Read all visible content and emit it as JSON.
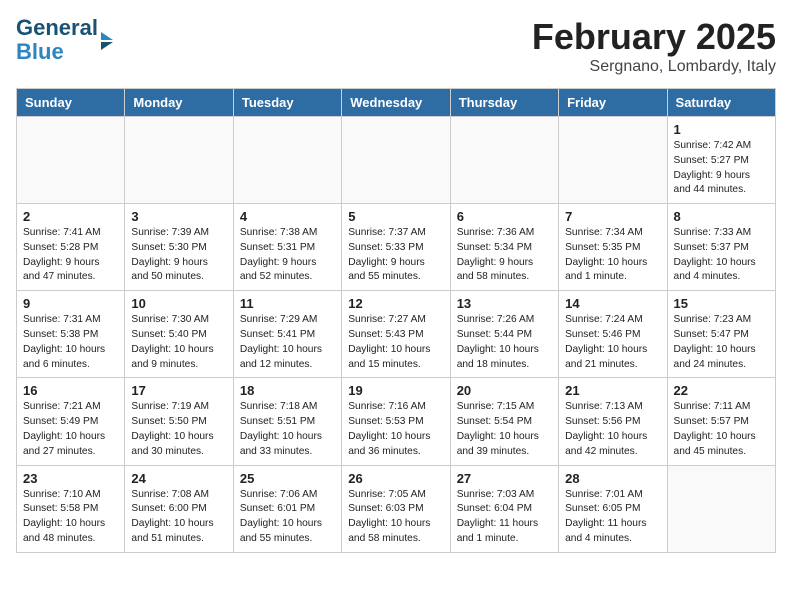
{
  "header": {
    "logo_line1": "General",
    "logo_line2": "Blue",
    "month_title": "February 2025",
    "location": "Sergnano, Lombardy, Italy"
  },
  "weekdays": [
    "Sunday",
    "Monday",
    "Tuesday",
    "Wednesday",
    "Thursday",
    "Friday",
    "Saturday"
  ],
  "weeks": [
    [
      {
        "day": "",
        "info": ""
      },
      {
        "day": "",
        "info": ""
      },
      {
        "day": "",
        "info": ""
      },
      {
        "day": "",
        "info": ""
      },
      {
        "day": "",
        "info": ""
      },
      {
        "day": "",
        "info": ""
      },
      {
        "day": "1",
        "info": "Sunrise: 7:42 AM\nSunset: 5:27 PM\nDaylight: 9 hours and 44 minutes."
      }
    ],
    [
      {
        "day": "2",
        "info": "Sunrise: 7:41 AM\nSunset: 5:28 PM\nDaylight: 9 hours and 47 minutes."
      },
      {
        "day": "3",
        "info": "Sunrise: 7:39 AM\nSunset: 5:30 PM\nDaylight: 9 hours and 50 minutes."
      },
      {
        "day": "4",
        "info": "Sunrise: 7:38 AM\nSunset: 5:31 PM\nDaylight: 9 hours and 52 minutes."
      },
      {
        "day": "5",
        "info": "Sunrise: 7:37 AM\nSunset: 5:33 PM\nDaylight: 9 hours and 55 minutes."
      },
      {
        "day": "6",
        "info": "Sunrise: 7:36 AM\nSunset: 5:34 PM\nDaylight: 9 hours and 58 minutes."
      },
      {
        "day": "7",
        "info": "Sunrise: 7:34 AM\nSunset: 5:35 PM\nDaylight: 10 hours and 1 minute."
      },
      {
        "day": "8",
        "info": "Sunrise: 7:33 AM\nSunset: 5:37 PM\nDaylight: 10 hours and 4 minutes."
      }
    ],
    [
      {
        "day": "9",
        "info": "Sunrise: 7:31 AM\nSunset: 5:38 PM\nDaylight: 10 hours and 6 minutes."
      },
      {
        "day": "10",
        "info": "Sunrise: 7:30 AM\nSunset: 5:40 PM\nDaylight: 10 hours and 9 minutes."
      },
      {
        "day": "11",
        "info": "Sunrise: 7:29 AM\nSunset: 5:41 PM\nDaylight: 10 hours and 12 minutes."
      },
      {
        "day": "12",
        "info": "Sunrise: 7:27 AM\nSunset: 5:43 PM\nDaylight: 10 hours and 15 minutes."
      },
      {
        "day": "13",
        "info": "Sunrise: 7:26 AM\nSunset: 5:44 PM\nDaylight: 10 hours and 18 minutes."
      },
      {
        "day": "14",
        "info": "Sunrise: 7:24 AM\nSunset: 5:46 PM\nDaylight: 10 hours and 21 minutes."
      },
      {
        "day": "15",
        "info": "Sunrise: 7:23 AM\nSunset: 5:47 PM\nDaylight: 10 hours and 24 minutes."
      }
    ],
    [
      {
        "day": "16",
        "info": "Sunrise: 7:21 AM\nSunset: 5:49 PM\nDaylight: 10 hours and 27 minutes."
      },
      {
        "day": "17",
        "info": "Sunrise: 7:19 AM\nSunset: 5:50 PM\nDaylight: 10 hours and 30 minutes."
      },
      {
        "day": "18",
        "info": "Sunrise: 7:18 AM\nSunset: 5:51 PM\nDaylight: 10 hours and 33 minutes."
      },
      {
        "day": "19",
        "info": "Sunrise: 7:16 AM\nSunset: 5:53 PM\nDaylight: 10 hours and 36 minutes."
      },
      {
        "day": "20",
        "info": "Sunrise: 7:15 AM\nSunset: 5:54 PM\nDaylight: 10 hours and 39 minutes."
      },
      {
        "day": "21",
        "info": "Sunrise: 7:13 AM\nSunset: 5:56 PM\nDaylight: 10 hours and 42 minutes."
      },
      {
        "day": "22",
        "info": "Sunrise: 7:11 AM\nSunset: 5:57 PM\nDaylight: 10 hours and 45 minutes."
      }
    ],
    [
      {
        "day": "23",
        "info": "Sunrise: 7:10 AM\nSunset: 5:58 PM\nDaylight: 10 hours and 48 minutes."
      },
      {
        "day": "24",
        "info": "Sunrise: 7:08 AM\nSunset: 6:00 PM\nDaylight: 10 hours and 51 minutes."
      },
      {
        "day": "25",
        "info": "Sunrise: 7:06 AM\nSunset: 6:01 PM\nDaylight: 10 hours and 55 minutes."
      },
      {
        "day": "26",
        "info": "Sunrise: 7:05 AM\nSunset: 6:03 PM\nDaylight: 10 hours and 58 minutes."
      },
      {
        "day": "27",
        "info": "Sunrise: 7:03 AM\nSunset: 6:04 PM\nDaylight: 11 hours and 1 minute."
      },
      {
        "day": "28",
        "info": "Sunrise: 7:01 AM\nSunset: 6:05 PM\nDaylight: 11 hours and 4 minutes."
      },
      {
        "day": "",
        "info": ""
      }
    ]
  ]
}
